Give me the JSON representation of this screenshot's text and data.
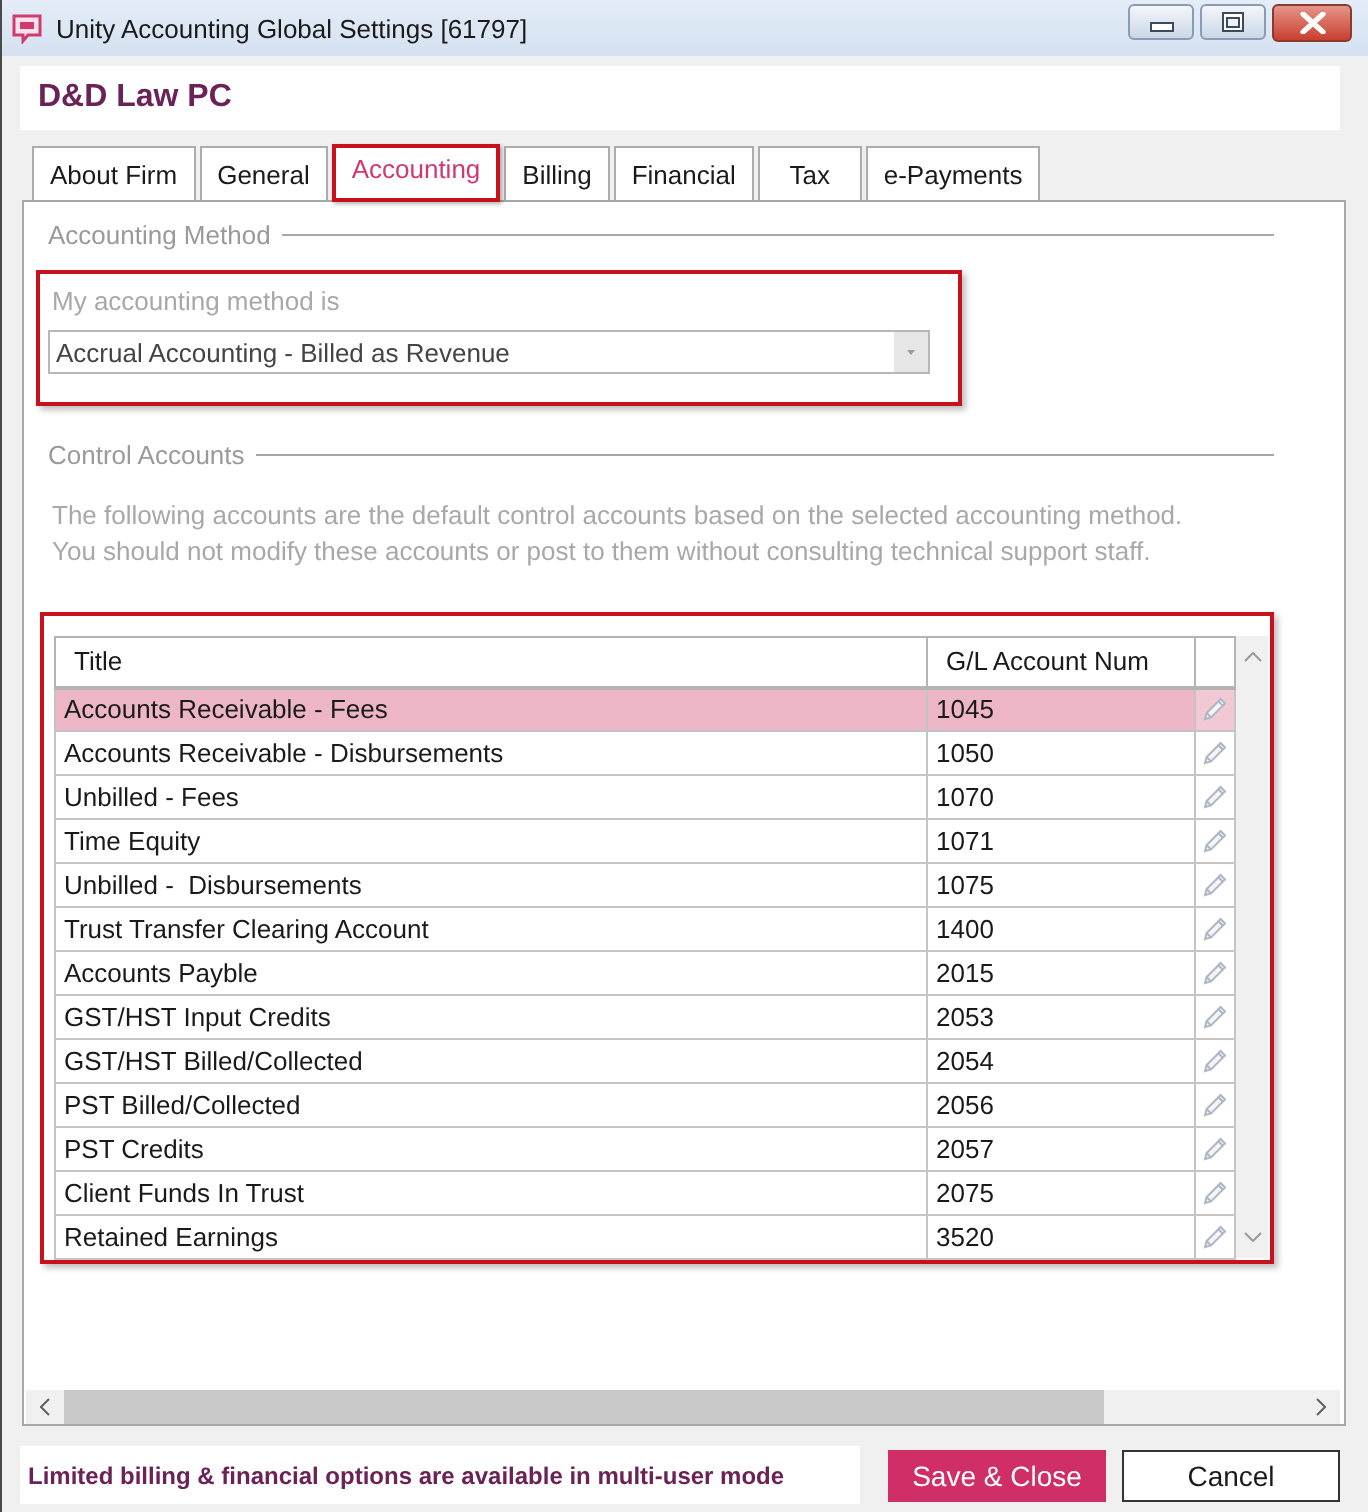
{
  "window": {
    "title": "Unity Accounting Global Settings [61797]"
  },
  "firm": {
    "name": "D&D Law PC"
  },
  "tabs": [
    {
      "label": "About Firm",
      "selected": false,
      "highlighted": false
    },
    {
      "label": "General",
      "selected": false,
      "highlighted": false
    },
    {
      "label": "Accounting",
      "selected": true,
      "highlighted": true
    },
    {
      "label": "Billing",
      "selected": false,
      "highlighted": false
    },
    {
      "label": "Financial",
      "selected": false,
      "highlighted": false
    },
    {
      "label": "Tax",
      "selected": false,
      "highlighted": false
    },
    {
      "label": "e-Payments",
      "selected": false,
      "highlighted": false
    }
  ],
  "accounting_method": {
    "heading": "Accounting Method",
    "highlighted": true,
    "label": "My accounting method is",
    "value": "Accrual Accounting - Billed as Revenue"
  },
  "control_accounts": {
    "heading": "Control Accounts",
    "description": [
      "The following accounts are the default control accounts based on the selected accounting method.",
      "You should not modify these accounts or post to them without consulting technical support staff."
    ],
    "highlighted": true,
    "columns": [
      "Title",
      "G/L Account Num"
    ],
    "rows": [
      {
        "title": "Accounts Receivable - Fees",
        "account": "1045",
        "selected": true
      },
      {
        "title": "Accounts Receivable - Disbursements",
        "account": "1050",
        "selected": false
      },
      {
        "title": "Unbilled - Fees",
        "account": "1070",
        "selected": false
      },
      {
        "title": "Time Equity",
        "account": "1071",
        "selected": false
      },
      {
        "title": "Unbilled -  Disbursements",
        "account": "1075",
        "selected": false
      },
      {
        "title": "Trust Transfer Clearing Account",
        "account": "1400",
        "selected": false
      },
      {
        "title": "Accounts Payble",
        "account": "2015",
        "selected": false
      },
      {
        "title": "GST/HST Input Credits",
        "account": "2053",
        "selected": false
      },
      {
        "title": "GST/HST Billed/Collected",
        "account": "2054",
        "selected": false
      },
      {
        "title": "PST Billed/Collected",
        "account": "2056",
        "selected": false
      },
      {
        "title": "PST Credits",
        "account": "2057",
        "selected": false
      },
      {
        "title": "Client Funds In Trust",
        "account": "2075",
        "selected": false
      },
      {
        "title": "Retained Earnings",
        "account": "3520",
        "selected": false
      }
    ]
  },
  "status_bar": {
    "message": "Limited billing & financial options are available in multi-user mode"
  },
  "buttons": [
    {
      "label": "Save & Close",
      "kind": "primary"
    },
    {
      "label": "Cancel",
      "kind": "secondary"
    }
  ]
}
